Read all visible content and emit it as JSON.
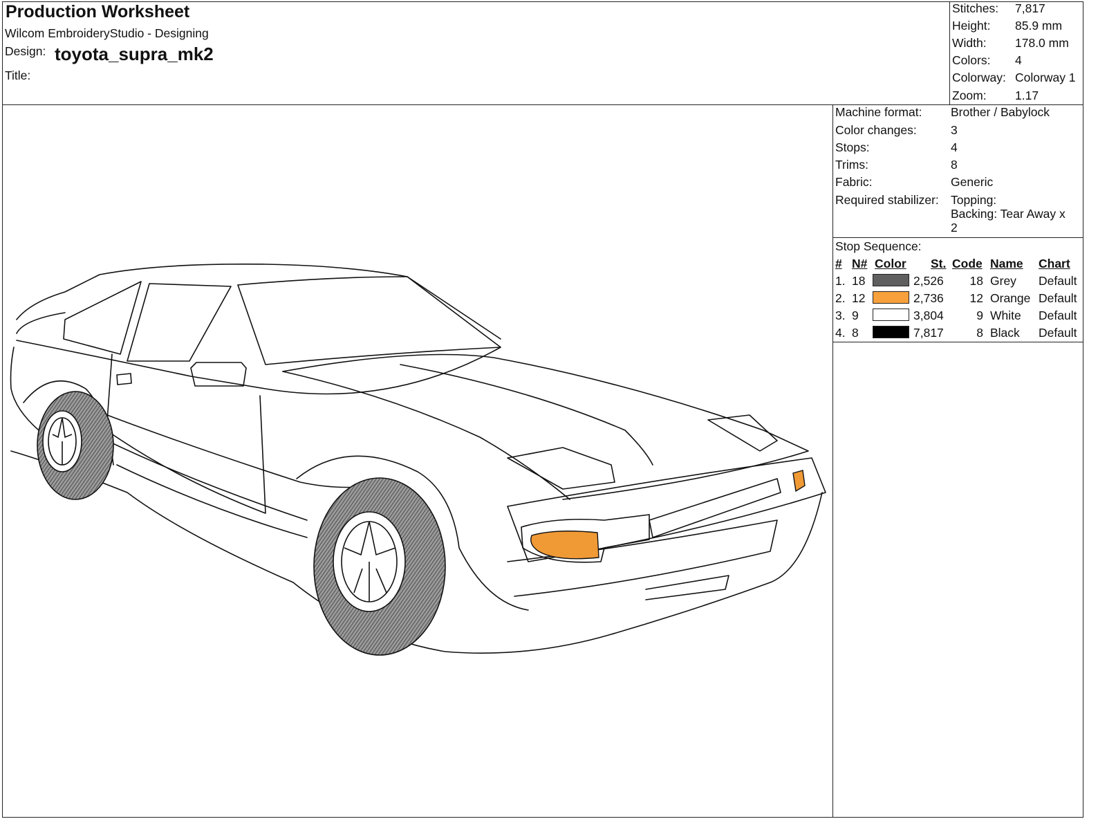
{
  "header": {
    "title": "Production Worksheet",
    "app": "Wilcom EmbroideryStudio - Designing",
    "design_label": "Design:",
    "design_name": "toyota_supra_mk2",
    "title_label": "Title:",
    "title_value": ""
  },
  "summary": [
    {
      "label": "Stitches:",
      "value": "7,817"
    },
    {
      "label": "Height:",
      "value": "85.9 mm"
    },
    {
      "label": "Width:",
      "value": "178.0 mm"
    },
    {
      "label": "Colors:",
      "value": "4"
    },
    {
      "label": "Colorway:",
      "value": "Colorway 1"
    },
    {
      "label": "Zoom:",
      "value": "1.17"
    }
  ],
  "machine_info": [
    {
      "label": "Machine format:",
      "value": "Brother / Babylock"
    },
    {
      "label": "Color changes:",
      "value": "3"
    },
    {
      "label": "Stops:",
      "value": "4"
    },
    {
      "label": "Trims:",
      "value": "8"
    },
    {
      "label": "Fabric:",
      "value": "Generic"
    },
    {
      "label": "Required stabilizer:",
      "value": "Topping:",
      "value2": "Backing: Tear Away x",
      "value3": "2"
    }
  ],
  "stop_sequence": {
    "title": "Stop Sequence:",
    "headers": [
      "#",
      "N#",
      "Color",
      "St.",
      "Code",
      "Name",
      "Chart"
    ],
    "rows": [
      {
        "num": "1.",
        "n": "18",
        "color": "#5f5f5f",
        "st": "2,526",
        "code": "18",
        "name": "Grey",
        "chart": "Default"
      },
      {
        "num": "2.",
        "n": "12",
        "color": "#f7a03c",
        "st": "2,736",
        "code": "12",
        "name": "Orange",
        "chart": "Default"
      },
      {
        "num": "3.",
        "n": "9",
        "color": "#ffffff",
        "st": "3,804",
        "code": "9",
        "name": "White",
        "chart": "Default"
      },
      {
        "num": "4.",
        "n": "8",
        "color": "#000000",
        "st": "7,817",
        "code": "8",
        "name": "Black",
        "chart": "Default"
      }
    ]
  },
  "icons": {
    "preview": "car-embroidery-design"
  }
}
